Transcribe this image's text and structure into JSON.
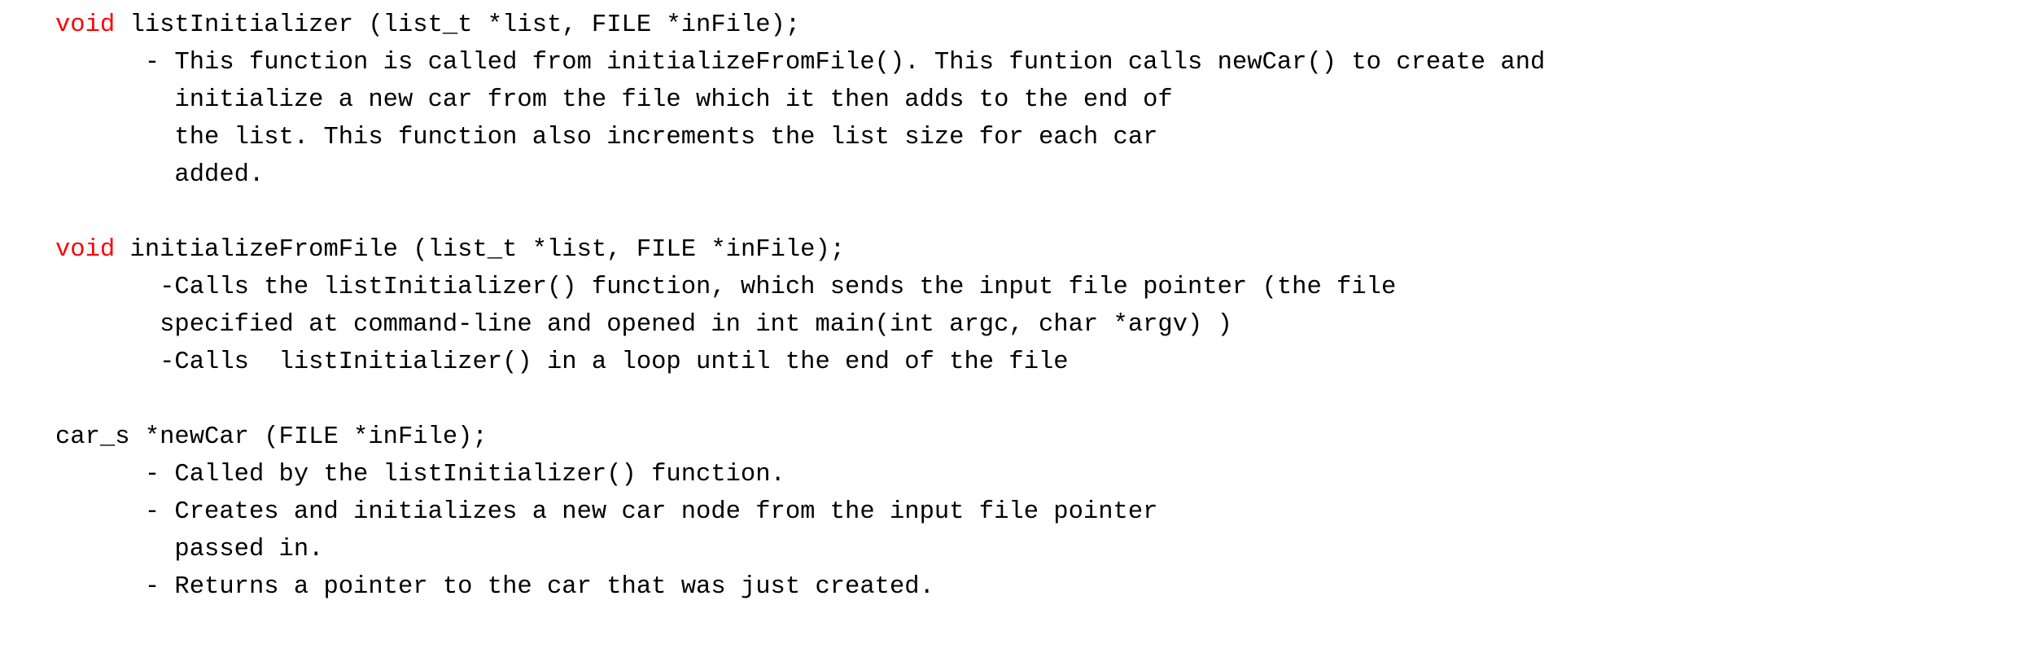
{
  "document": {
    "type": "plain-text-code-notes",
    "background_color": "#ffffff",
    "text_color": "#000000",
    "keyword_color": "#ff0000",
    "font_style": "monospace",
    "sections": [
      {
        "id": "list-initializer",
        "signature": {
          "keyword": "void",
          "rest": " listInitializer (list_t *list, FILE *inFile);"
        },
        "description_lines": [
          "      - This function is called from initializeFromFile(). This funtion calls newCar() to create and",
          "        initialize a new car from the file which it then adds to the end of",
          "        the list. This function also increments the list size for each car",
          "        added."
        ]
      },
      {
        "id": "initialize-from-file",
        "signature": {
          "keyword": "void",
          "rest": " initializeFromFile (list_t *list, FILE *inFile);"
        },
        "description_lines": [
          "       -Calls the listInitializer() function, which sends the input file pointer (the file",
          "       specified at command-line and opened in int main(int argc, char *argv) )",
          "       -Calls  listInitializer() in a loop until the end of the file"
        ]
      },
      {
        "id": "new-car",
        "signature": {
          "keyword": "",
          "rest": "car_s *newCar (FILE *inFile);"
        },
        "description_lines": [
          "      - Called by the listInitializer() function.",
          "      - Creates and initializes a new car node from the input file pointer",
          "        passed in.",
          "      - Returns a pointer to the car that was just created."
        ]
      }
    ]
  }
}
